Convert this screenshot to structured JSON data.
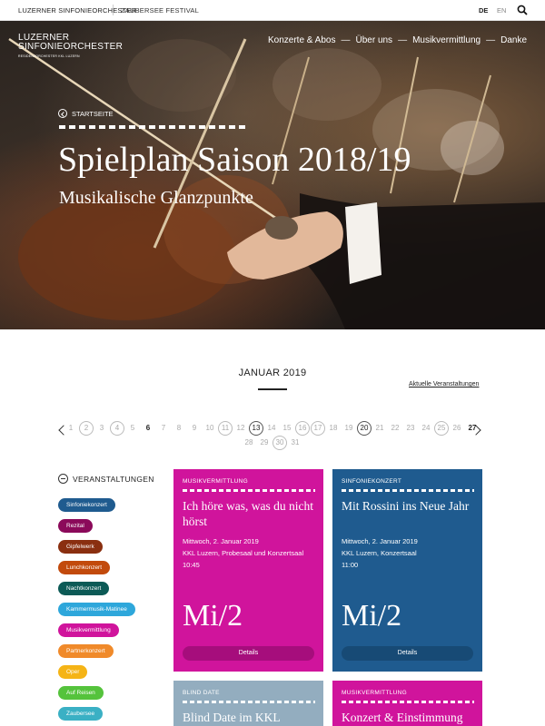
{
  "topbar": {
    "site1": "LUZERNER SINFONIEORCHESTER",
    "site2": "ZAUBERSEE FESTIVAL",
    "lang_de": "DE",
    "lang_en": "EN",
    "search_icon": "search-icon"
  },
  "logo": {
    "line1": "LUZERNER",
    "line2": "SINFONIEORCHESTER",
    "line3": "RESIDENZORCHESTER KKL LUZERN"
  },
  "nav": {
    "items": [
      "Konzerte & Abos",
      "Über uns",
      "Musikvermittlung",
      "Danke"
    ],
    "separator": "—"
  },
  "hero": {
    "back_label": "STARTSEITE",
    "title": "Spielplan Saison 2018/19",
    "subtitle": "Musikalische Glanzpunkte"
  },
  "calendar": {
    "month": "JANUAR 2019",
    "current_link": "Aktuelle Veranstaltungen",
    "days_row1": [
      "1",
      "2",
      "3",
      "4",
      "5",
      "6",
      "7",
      "8",
      "9",
      "10",
      "11",
      "12",
      "13",
      "14",
      "15",
      "16",
      "17",
      "18",
      "19",
      "20",
      "21",
      "22",
      "23",
      "24",
      "25",
      "26",
      "27"
    ],
    "days_row2": [
      "28",
      "29",
      "30",
      "31"
    ]
  },
  "filters": {
    "heading": "VERANSTALTUNGEN",
    "tags": [
      {
        "label": "Sinfoniekonzert",
        "color": "#1f5b8f"
      },
      {
        "label": "Rezital",
        "color": "#8b0a5a"
      },
      {
        "label": "Gipfelwerk",
        "color": "#8a2f10"
      },
      {
        "label": "Lunchkonzert",
        "color": "#c24a0c"
      },
      {
        "label": "Nachtkonzert",
        "color": "#0c5a56"
      },
      {
        "label": "Kammermusik-Matinee",
        "color": "#2ea7db"
      },
      {
        "label": "Musikvermittlung",
        "color": "#d0149c"
      },
      {
        "label": "Partnerkonzert",
        "color": "#f08a2a"
      },
      {
        "label": "Oper",
        "color": "#f5b416"
      },
      {
        "label": "Auf Reisen",
        "color": "#55c33c"
      },
      {
        "label": "Zaubersee",
        "color": "#3ab0c4"
      }
    ]
  },
  "events": [
    {
      "category": "MUSIKVERMITTLUNG",
      "title": "Ich höre was, was du nicht hörst",
      "date": "Mittwoch, 2. Januar 2019",
      "venue": "KKL Luzern, Probesaal und Konzertsaal",
      "time": "10:45",
      "big": "Mi/2",
      "button": "Details",
      "color": "#d0149c",
      "button_color": "#a60d7c"
    },
    {
      "category": "SINFONIEKONZERT",
      "title": "Mit Rossini ins Neue Jahr",
      "date": "Mittwoch, 2. Januar 2019",
      "venue": "KKL Luzern, Konzertsaal",
      "time": "11:00",
      "big": "Mi/2",
      "button": "Details",
      "color": "#1f5b8f",
      "button_color": "#174a75"
    },
    {
      "category": "BLIND DATE",
      "title": "Blind Date im KKL",
      "color": "#93adbf"
    },
    {
      "category": "MUSIKVERMITTLUNG",
      "title": "Konzert & Einstimmung",
      "color": "#d0149c"
    }
  ]
}
